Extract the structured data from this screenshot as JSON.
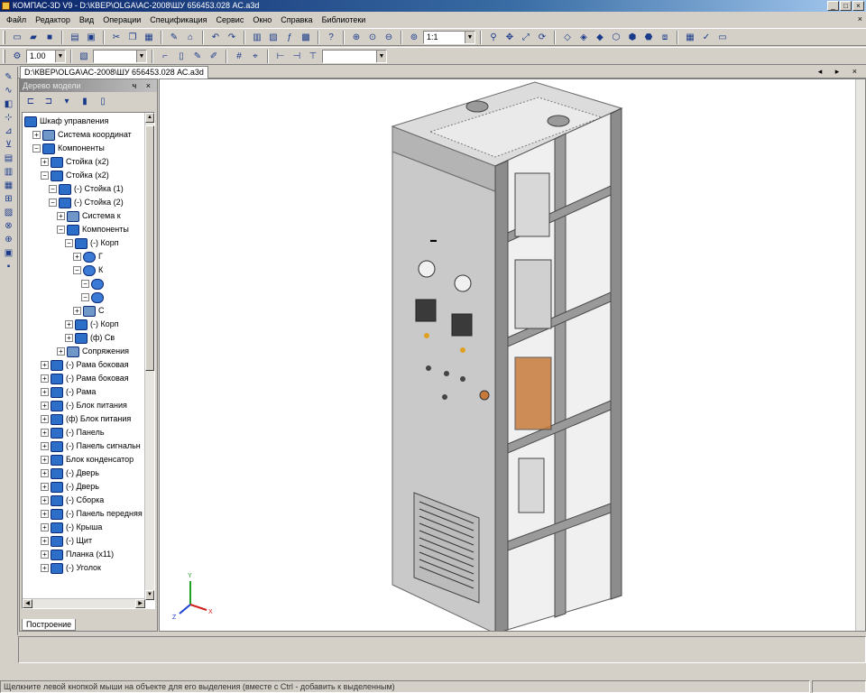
{
  "window": {
    "title": "КОМПАС-3D V9 - D:\\КВЕР\\OLGA\\АС-2008\\ШУ 656453.028 АС.a3d",
    "min": "_",
    "max": "□",
    "close": "×"
  },
  "menu": {
    "items": [
      "Файл",
      "Редактор",
      "Вид",
      "Операции",
      "Спецификация",
      "Сервис",
      "Окно",
      "Справка",
      "Библиотеки"
    ],
    "close": "×"
  },
  "toolbar": {
    "scale_value": "1:1",
    "line_width": "1.00"
  },
  "document_tab": {
    "label": "D:\\КВЕР\\OLGA\\АС-2008\\ШУ 656453.028 АС.a3d",
    "controls": "◂ ▸ ×"
  },
  "tree_panel": {
    "title": "Дерево модели",
    "header_buttons": "ч ×",
    "bottom_tab": "Построение",
    "items": [
      {
        "label": "Шкаф управления",
        "level": 0,
        "expander": "",
        "icon": "assembly-icon"
      },
      {
        "label": "Система координат",
        "level": 1,
        "expander": "+",
        "icon": "coordinate-system-icon"
      },
      {
        "label": "Компоненты",
        "level": 1,
        "expander": "−",
        "icon": "folder-icon"
      },
      {
        "label": "Стойка (x2)",
        "level": 2,
        "expander": "+",
        "icon": "component-icon"
      },
      {
        "label": "Стойка (x2)",
        "level": 2,
        "expander": "−",
        "icon": "component-icon"
      },
      {
        "label": "(-) Стойка (1)",
        "level": 3,
        "expander": "−",
        "icon": "component-icon"
      },
      {
        "label": "(-) Стойка (2)",
        "level": 3,
        "expander": "−",
        "icon": "component-icon"
      },
      {
        "label": "Система к",
        "level": 4,
        "expander": "+",
        "icon": "coordinate-system-icon"
      },
      {
        "label": "Компоненты",
        "level": 4,
        "expander": "−",
        "icon": "folder-icon"
      },
      {
        "label": "(-) Корп",
        "level": 5,
        "expander": "−",
        "icon": "component-icon"
      },
      {
        "label": "Г",
        "level": 6,
        "expander": "+",
        "icon": "part-icon"
      },
      {
        "label": "К",
        "level": 6,
        "expander": "−",
        "icon": "part-icon"
      },
      {
        "label": "",
        "level": 7,
        "expander": "−",
        "icon": "part-icon"
      },
      {
        "label": "",
        "level": 7,
        "expander": "−",
        "icon": "part-icon"
      },
      {
        "label": "С",
        "level": 6,
        "expander": "+",
        "icon": "mate-icon"
      },
      {
        "label": "(-) Корп",
        "level": 5,
        "expander": "+",
        "icon": "component-icon"
      },
      {
        "label": "(ф) Св",
        "level": 5,
        "expander": "+",
        "icon": "component-icon"
      },
      {
        "label": "Сопряжения",
        "level": 4,
        "expander": "+",
        "icon": "mate-icon"
      },
      {
        "label": "(-) Рама боковая",
        "level": 2,
        "expander": "+",
        "icon": "component-icon"
      },
      {
        "label": "(-) Рама боковая",
        "level": 2,
        "expander": "+",
        "icon": "component-icon"
      },
      {
        "label": "(-) Рама",
        "level": 2,
        "expander": "+",
        "icon": "component-icon"
      },
      {
        "label": "(-) Блок питания",
        "level": 2,
        "expander": "+",
        "icon": "component-icon"
      },
      {
        "label": "(ф) Блок питания",
        "level": 2,
        "expander": "+",
        "icon": "component-icon"
      },
      {
        "label": "(-) Панель",
        "level": 2,
        "expander": "+",
        "icon": "component-icon"
      },
      {
        "label": "(-) Панель сигнальн",
        "level": 2,
        "expander": "+",
        "icon": "component-icon"
      },
      {
        "label": "Блок конденсатор",
        "level": 2,
        "expander": "+",
        "icon": "component-icon"
      },
      {
        "label": "(-) Дверь",
        "level": 2,
        "expander": "+",
        "icon": "component-icon"
      },
      {
        "label": "(-) Дверь",
        "level": 2,
        "expander": "+",
        "icon": "component-icon"
      },
      {
        "label": "(-) Сборка",
        "level": 2,
        "expander": "+",
        "icon": "component-icon"
      },
      {
        "label": "(-) Панель передняя",
        "level": 2,
        "expander": "+",
        "icon": "component-icon"
      },
      {
        "label": "(-) Крыша",
        "level": 2,
        "expander": "+",
        "icon": "component-icon"
      },
      {
        "label": "(-) Щит",
        "level": 2,
        "expander": "+",
        "icon": "component-icon"
      },
      {
        "label": "Планка (x11)",
        "level": 2,
        "expander": "+",
        "icon": "component-icon"
      },
      {
        "label": "(-) Уголок",
        "level": 2,
        "expander": "+",
        "icon": "component-icon"
      }
    ]
  },
  "viewport": {
    "axis_labels": {
      "x": "X",
      "y": "Y",
      "z": "Z"
    },
    "colors": {
      "panel": "#c9c9c9",
      "frame": "#8c8c8c",
      "dark": "#3a3a3a",
      "accent": "#c87a3a"
    }
  },
  "statusbar": {
    "text": "Щелкните левой кнопкой мыши на объекте для его выделения (вместе с Ctrl - добавить к выделенным)"
  }
}
